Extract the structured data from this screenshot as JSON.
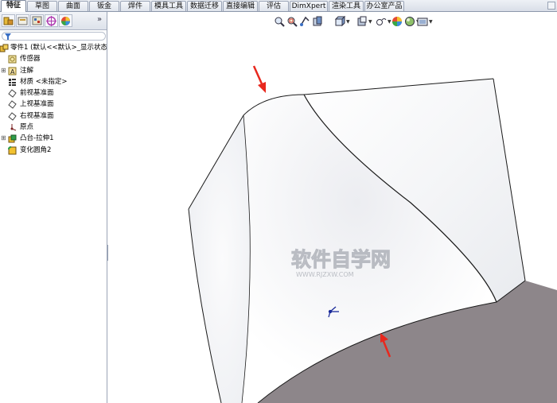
{
  "command_tabs": [
    {
      "label": "特征",
      "active": true
    },
    {
      "label": "草图",
      "active": false
    },
    {
      "label": "曲面",
      "active": false
    },
    {
      "label": "钣金",
      "active": false
    },
    {
      "label": "焊件",
      "active": false
    },
    {
      "label": "模具工具",
      "active": false
    },
    {
      "label": "数据迁移",
      "active": false
    },
    {
      "label": "直接编辑",
      "active": false
    },
    {
      "label": "评估",
      "active": false
    },
    {
      "label": "DimXpert",
      "active": false
    },
    {
      "label": "渲染工具",
      "active": false
    },
    {
      "label": "办公室产品",
      "active": false
    }
  ],
  "feature_tree": {
    "more_label": "»",
    "root_label": "零件1 (默认<<默认>_显示状态",
    "items": [
      {
        "label": "传感器",
        "icon": "sensor-icon",
        "expandable": false
      },
      {
        "label": "注解",
        "icon": "annotation-icon",
        "expandable": true
      },
      {
        "label": "材质 <未指定>",
        "icon": "material-icon",
        "expandable": false
      },
      {
        "label": "前视基准面",
        "icon": "plane-icon",
        "expandable": false
      },
      {
        "label": "上视基准面",
        "icon": "plane-icon",
        "expandable": false
      },
      {
        "label": "右视基准面",
        "icon": "plane-icon",
        "expandable": false
      },
      {
        "label": "原点",
        "icon": "origin-icon",
        "expandable": false
      },
      {
        "label": "凸台-拉伸1",
        "icon": "boss-extrude-icon",
        "expandable": true
      },
      {
        "label": "变化圆角2",
        "icon": "variable-fillet-icon",
        "expandable": false
      }
    ]
  },
  "view_toolbar_icons": [
    "zoom-to-fit-icon",
    "zoom-area-icon",
    "previous-view-icon",
    "section-view-icon",
    "view-orientation-icon",
    "display-style-icon",
    "hide-show-items-icon",
    "edit-appearance-icon",
    "apply-scene-icon",
    "view-settings-icon"
  ],
  "watermark": {
    "main": "软件自学网",
    "sub": "WWW.RJZXW.COM"
  },
  "colors": {
    "accent_arrow": "#e8281e",
    "shaded_face": "#8d868a",
    "model_edge": "#1a1a1a"
  }
}
